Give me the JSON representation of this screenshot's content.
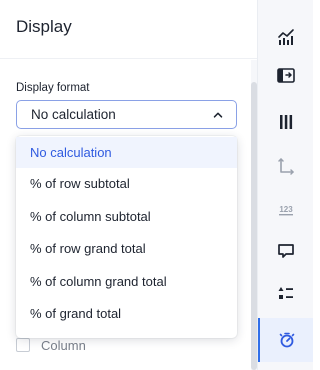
{
  "panel": {
    "title": "Display",
    "format_label": "Display format",
    "selected_value": "No calculation"
  },
  "menu": {
    "options": [
      "No calculation",
      "% of row subtotal",
      "% of column subtotal",
      "% of row grand total",
      "% of column grand total",
      "% of grand total"
    ],
    "selected_index": 0
  },
  "column_checkbox": {
    "label": "Column",
    "checked": false
  },
  "rail": {
    "icons": [
      "chart-icon",
      "pivot-icon",
      "columns-icon",
      "axes-icon",
      "number-format-icon",
      "comment-icon",
      "list-settings-icon",
      "display-settings-icon"
    ],
    "active_index": 7
  },
  "colors": {
    "accent": "#2f5ae0",
    "select_border": "#8aa1e6",
    "rail_bg": "#f6f7fa",
    "selected_bg": "#f0f4fe",
    "icon_dark": "#1d232f",
    "icon_muted": "#9aa1ad"
  }
}
